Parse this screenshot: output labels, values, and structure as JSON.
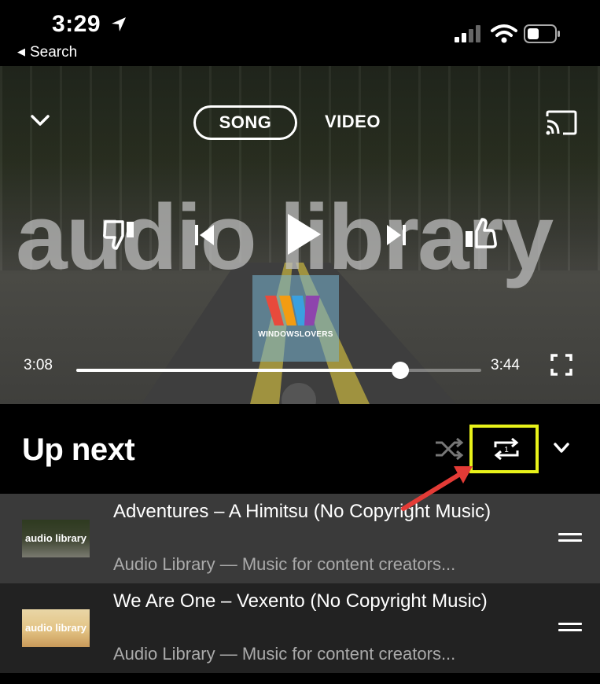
{
  "status_bar": {
    "time": "3:29",
    "back_label": "Search",
    "icons": [
      "location-arrow-icon",
      "signal-icon",
      "wifi-icon",
      "battery-icon"
    ]
  },
  "player": {
    "tabs": [
      {
        "label": "SONG",
        "selected": true
      },
      {
        "label": "VIDEO",
        "selected": false
      }
    ],
    "video_overlay_text": "audio library",
    "logo_brand": "WINDOWSLOVERS",
    "current_time": "3:08",
    "duration": "3:44",
    "progress": 0.8,
    "controls": [
      "thumbs-down-icon",
      "previous-icon",
      "play-icon",
      "next-icon",
      "thumbs-up-icon"
    ]
  },
  "up_next": {
    "title": "Up next",
    "highlight_color": "#e8f21a",
    "arrow_color": "#e33b36"
  },
  "queue": [
    {
      "thumb_text": "audio library",
      "title": "Adventures – A Himitsu (No Copyright Music)",
      "subtitle": "Audio Library — Music for content creators..."
    },
    {
      "thumb_text": "audio library",
      "title": "We Are One – Vexento (No Copyright Music)",
      "subtitle": "Audio Library — Music for content creators..."
    }
  ]
}
